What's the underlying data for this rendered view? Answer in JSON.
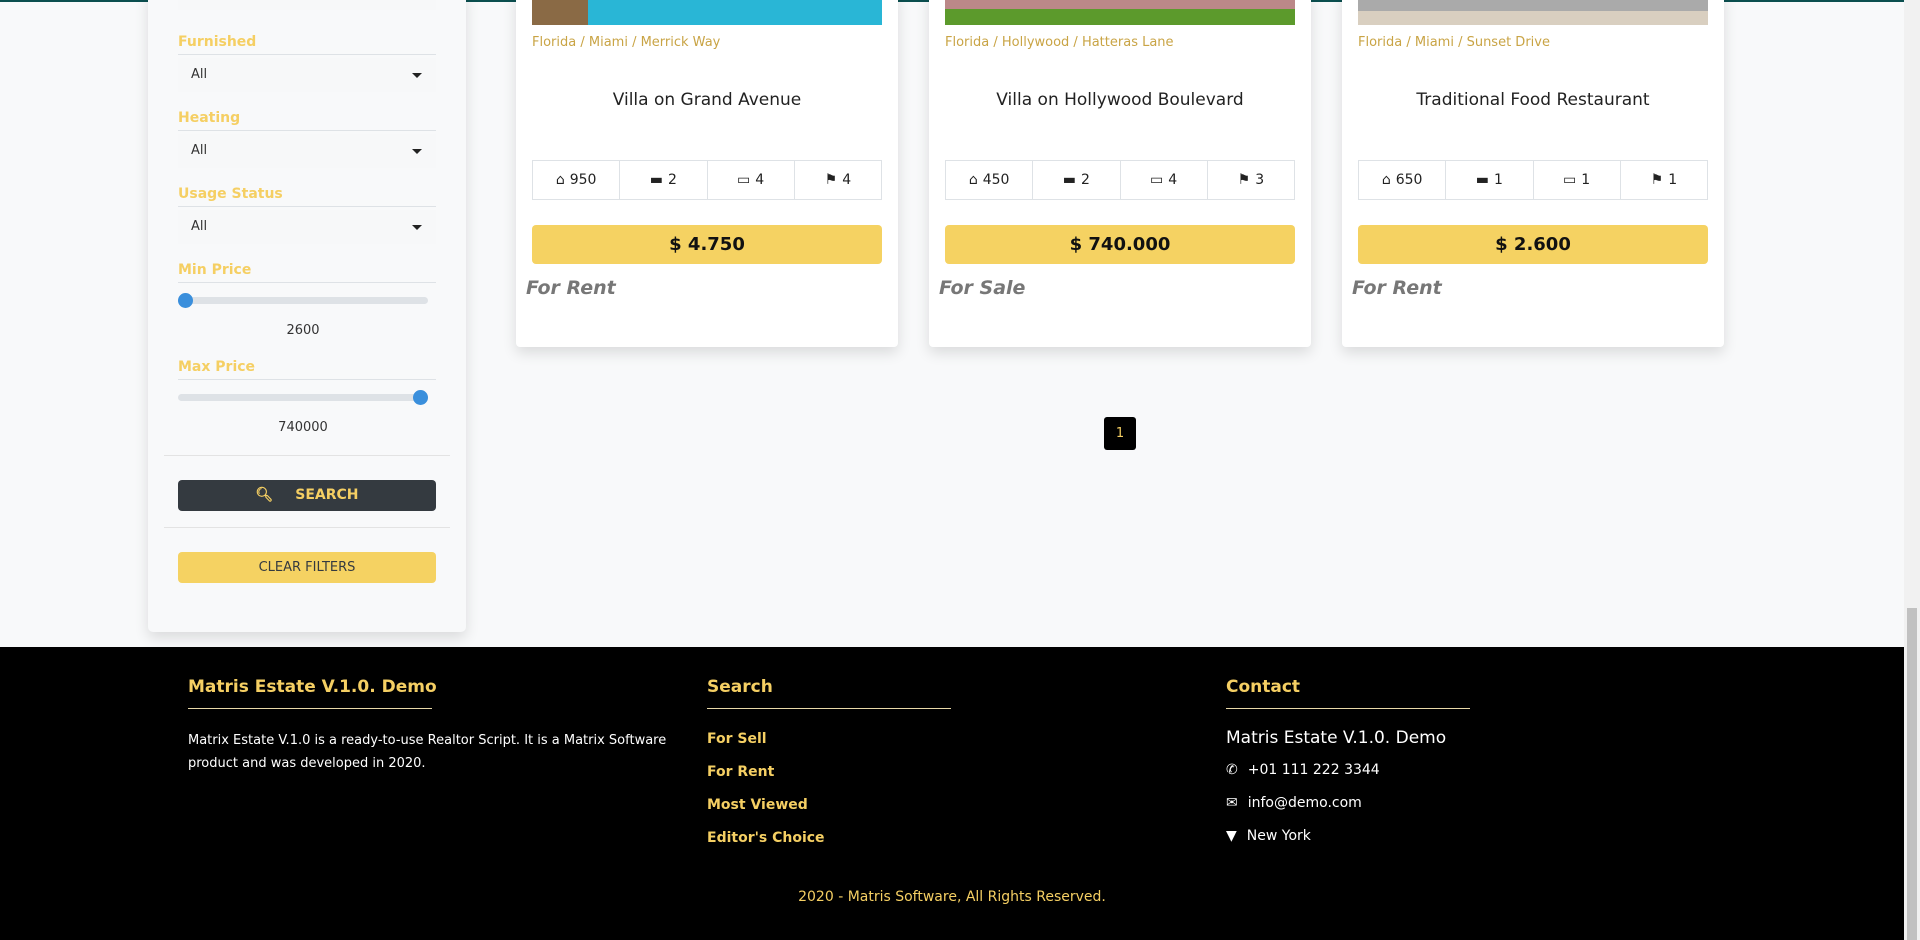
{
  "filters": {
    "furnished": {
      "label": "Furnished",
      "value": "All"
    },
    "heating": {
      "label": "Heating",
      "value": "All"
    },
    "usage_status": {
      "label": "Usage Status",
      "value": "All"
    },
    "min_price": {
      "label": "Min Price",
      "value": "2600",
      "fraction": 0
    },
    "max_price": {
      "label": "Max Price",
      "value": "740000",
      "fraction": 1
    },
    "search_label": "SEARCH",
    "clear_label": "CLEAR FILTERS"
  },
  "listings": [
    {
      "location": "Florida / Miami / Merrick Way",
      "title": "Villa on Grand Avenue",
      "area": "950",
      "rooms": "2",
      "beds": "4",
      "baths": "4",
      "price": "$ 4.750",
      "status": "For Rent"
    },
    {
      "location": "Florida / Hollywood / Hatteras Lane",
      "title": "Villa on Hollywood Boulevard",
      "area": "450",
      "rooms": "2",
      "beds": "4",
      "baths": "3",
      "price": "$ 740.000",
      "status": "For Sale"
    },
    {
      "location": "Florida / Miami / Sunset Drive",
      "title": "Traditional Food Restaurant",
      "area": "650",
      "rooms": "1",
      "beds": "1",
      "baths": "1",
      "price": "$ 2.600",
      "status": "For Rent"
    }
  ],
  "pagination": {
    "current": "1"
  },
  "footer": {
    "about_title": "Matris Estate V.1.0. Demo",
    "about_text": "Matrix Estate V.1.0 is a ready-to-use Realtor Script. It is a Matrix Software product and was developed in 2020.",
    "search_title": "Search",
    "links": [
      "For Sell",
      "For Rent",
      "Most Viewed",
      "Editor's Choice"
    ],
    "contact_title": "Contact",
    "contact_name": "Matris Estate V.1.0. Demo",
    "phone": "+01 111 222 3344",
    "email": "info@demo.com",
    "address": "New York",
    "copyright": "2020 - Matris Software, All Rights Reserved."
  },
  "colors": {
    "accent": "#f5cf63",
    "dark": "#343a40",
    "slider": "#3a8fdc"
  }
}
